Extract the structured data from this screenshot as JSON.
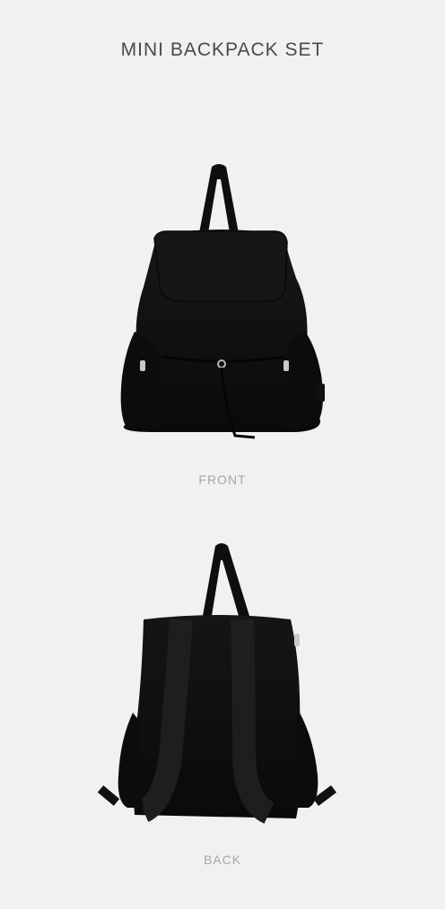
{
  "page": {
    "title": "MINI BACKPACK SET"
  },
  "views": [
    {
      "caption": "FRONT",
      "image": "black-mini-backpack-front-view"
    },
    {
      "caption": "BACK",
      "image": "black-mini-backpack-back-view"
    }
  ]
}
